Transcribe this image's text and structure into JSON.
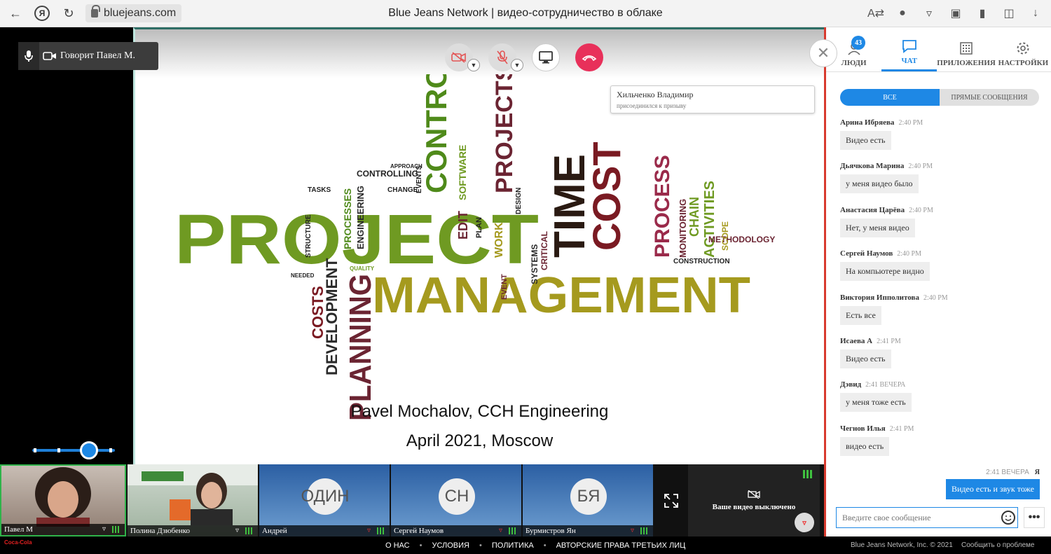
{
  "browser": {
    "url": "bluejeans.com",
    "title": "Blue Jeans Network | видео-сотрудничество в облаке",
    "ya_label": "Я"
  },
  "speaker": {
    "label": "Говорит Павел М."
  },
  "notification": {
    "name": "Хильченко Владимир",
    "text": "присоединился к призыву"
  },
  "slide": {
    "author": "Pavel Mochalov, CCH Engineering",
    "date": "April 2021, Moscow",
    "words": {
      "project": "PROJECT",
      "management": "MANAGEMENT",
      "time": "TIME",
      "cost": "COST",
      "control": "CONTROL",
      "projects": "PROJECTS",
      "planning": "PLANNING",
      "process": "PROCESS",
      "development": "DEVELOPMENT",
      "costs": "COSTS",
      "activities": "ACTIVITIES",
      "chain": "CHAIN",
      "controlling": "CONTROLLING",
      "engineering": "ENGINEERING",
      "processes": "PROCESSES",
      "software": "SOFTWARE",
      "edit": "EDIT",
      "work": "WORK",
      "methodology": "METHODOLOGY",
      "construction": "CONSTRUCTION",
      "monitoring": "MONITORING",
      "scope": "SCOPE",
      "systems": "SYSTEMS",
      "critical": "CRITICAL",
      "event": "EVENT",
      "plan": "PLAN",
      "design": "DESIGN",
      "structure": "STRUCTURE",
      "tasks": "TASKS",
      "change": "CHANGE",
      "events": "EVENTS",
      "approach": "APPROACH",
      "quality": "QUALITY",
      "needed": "NEEDED"
    }
  },
  "right_panel": {
    "tabs": [
      {
        "label": "ЛЮДИ",
        "badge": "43"
      },
      {
        "label": "ЧАТ"
      },
      {
        "label": "ПРИЛОЖЕНИЯ"
      },
      {
        "label": "НАСТРОЙКИ"
      }
    ],
    "segments": {
      "all": "ВСЕ",
      "direct": "ПРЯМЫЕ СООБЩЕНИЯ"
    },
    "messages": [
      {
        "who": "Арина Ибряева",
        "time": "2:40 PM",
        "text": "Видео есть"
      },
      {
        "who": "Дьячкова Марина",
        "time": "2:40 PM",
        "text": "у меня видео было"
      },
      {
        "who": "Анастасия Царёва",
        "time": "2:40 PM",
        "text": "Нет, у меня видео"
      },
      {
        "who": "Сергей Наумов",
        "time": "2:40 PM",
        "text": "На компьютере видно"
      },
      {
        "who": "Виктория Ипполитова",
        "time": "2:40 PM",
        "text": "Есть все"
      },
      {
        "who": "Исаева А",
        "time": "2:41 PM",
        "text": "Видео есть"
      },
      {
        "who": "Дэвид",
        "time": "2:41 ВЕЧЕРА",
        "text": "у меня тоже есть"
      },
      {
        "who": "Чегнов Илья",
        "time": "2:41 PM",
        "text": "видео есть"
      }
    ],
    "my_message": {
      "time": "2:41 ВЕЧЕРА",
      "who": "Я",
      "text": "Видео есть и звук тоже"
    },
    "input_placeholder": "Введите свое сообщение",
    "more": "•••"
  },
  "participants": [
    {
      "name": "Павел М",
      "type": "photo"
    },
    {
      "name": "Полина Дзюбенко",
      "type": "photo"
    },
    {
      "name": "Андрей",
      "initials": "ОДИН",
      "type": "avatar"
    },
    {
      "name": "Сергей Наумов",
      "initials": "СН",
      "type": "avatar"
    },
    {
      "name": "Бурмистров Ян",
      "initials": "БЯ",
      "type": "avatar"
    }
  ],
  "self_view": {
    "label": "Ваше видео выключено"
  },
  "footer": {
    "links": [
      "О НАС",
      "УСЛОВИЯ",
      "ПОЛИТИКА",
      "АВТОРСКИЕ ПРАВА ТРЕТЬИХ ЛИЦ"
    ],
    "separator": "•",
    "copyright": "Blue Jeans Network, Inc. © 2021",
    "report": "Сообщить о проблеме",
    "brand": "Coca-Cola"
  },
  "colors": {
    "accent": "#1e88e5",
    "hangup": "#e8305a",
    "word_green": "#6f9a22",
    "word_olive": "#a59a1e",
    "word_maroon": "#6b2432"
  }
}
